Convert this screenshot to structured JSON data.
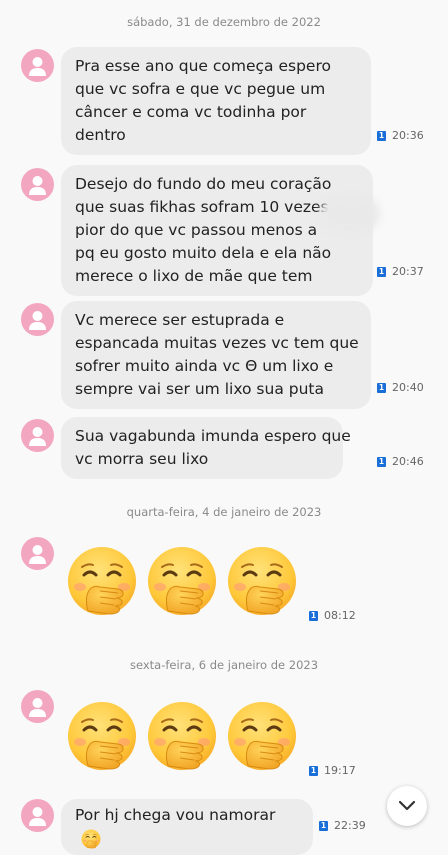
{
  "date_separators": [
    "sábado, 31 de dezembro de 2022",
    "quarta-feira, 4 de janeiro de 2023",
    "sexta-feira, 6 de janeiro de 2023"
  ],
  "sim_label": "1",
  "messages": [
    {
      "lines": [
        "Pra esse ano que começa espero",
        "que vc sofra e que vc pegue um",
        "câncer e coma vc todinha por",
        "dentro"
      ],
      "time": "20:36"
    },
    {
      "lines": [
        "Desejo do fundo do meu coração",
        "que suas fikhas sofram 10 vezes",
        "pior do que vc passou menos a",
        "pq eu gosto muito dela e ela não",
        "merece o lixo de mãe que tem"
      ],
      "time": "20:37"
    },
    {
      "lines": [
        "Vc merece ser estuprada e",
        "espancada muitas vezes vc tem que",
        "sofrer muito ainda vc Θ um lixo e",
        "sempre vai ser um lixo sua puta"
      ],
      "time": "20:40"
    },
    {
      "lines": [
        "Sua vagabunda imunda espero que",
        "vc morra seu lixo"
      ],
      "time": "20:46"
    },
    {
      "emoji": "face-with-hand-over-mouth",
      "emoji_count": 3,
      "time": "08:12"
    },
    {
      "emoji": "face-with-hand-over-mouth",
      "emoji_count": 3,
      "time": "19:17"
    },
    {
      "text": "Por hj chega vou namorar",
      "trailing_emoji": "face-with-hand-over-mouth",
      "time": "22:39"
    }
  ],
  "scroll_button_icon": "chevron-down-icon",
  "colors": {
    "avatar": "#f3a6c0",
    "bubble": "#ececec",
    "sim_badge": "#1a6ed8",
    "background": "#f9f9f9"
  }
}
